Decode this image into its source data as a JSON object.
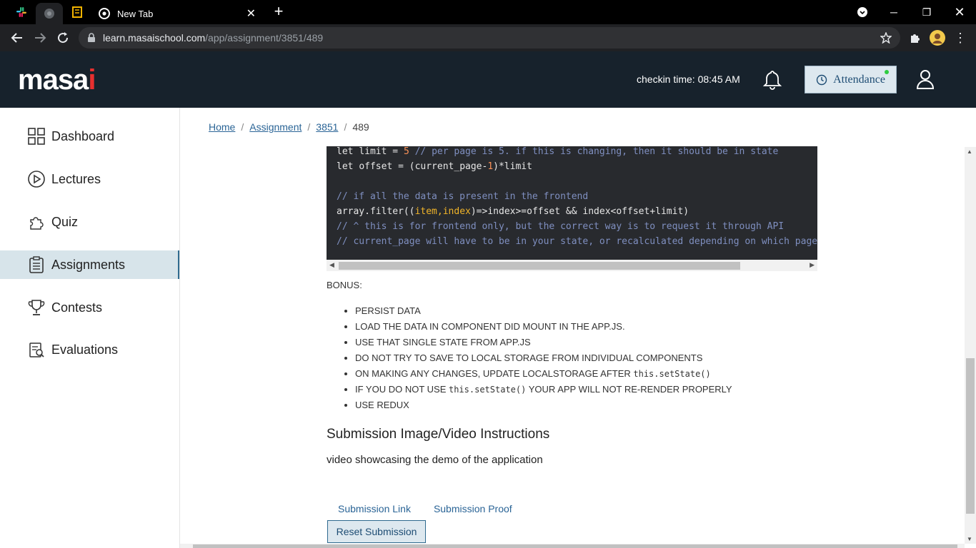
{
  "browser": {
    "active_tab_title": "New Tab",
    "url_host": "learn.masaischool.com",
    "url_path": "/app/assignment/3851/489"
  },
  "header": {
    "logo_main": "masa",
    "logo_accent": "i",
    "checkin": "checkin time: 08:45 AM",
    "attendance_label": "Attendance"
  },
  "sidebar": {
    "items": [
      {
        "label": "Dashboard",
        "icon": "dashboard-icon"
      },
      {
        "label": "Lectures",
        "icon": "play-circle-icon"
      },
      {
        "label": "Quiz",
        "icon": "puzzle-icon"
      },
      {
        "label": "Assignments",
        "icon": "clipboard-icon",
        "active": true
      },
      {
        "label": "Contests",
        "icon": "trophy-icon"
      },
      {
        "label": "Evaluations",
        "icon": "evaluation-icon"
      }
    ]
  },
  "breadcrumb": {
    "home": "Home",
    "assignment": "Assignment",
    "id": "3851",
    "current": "489"
  },
  "code": {
    "l1_kw": "let ",
    "l1_var": "limit = ",
    "l1_num": "5",
    "l1_cm": " // per page is 5. if this is changing, then it should be in state",
    "l2_kw": "let ",
    "l2_a": "offset = (current_page-",
    "l2_num": "1",
    "l2_b": ")*limit",
    "l4_cm": "// if all the data is present in the frontend",
    "l5_a": "array.filter((",
    "l5_p": "item,index",
    "l5_b": ")=>index>=offset && index<offset+limit)",
    "l6_cm": "// ^ this is for frontend only, but the correct way is to request it through API",
    "l7_cm": "// current_page will have to be in your state, or recalculated depending on which page i"
  },
  "bonus": {
    "title": "BONUS:",
    "items": [
      "PERSIST DATA",
      "LOAD THE DATA IN COMPONENT DID MOUNT IN THE APP.JS.",
      "USE THAT SINGLE STATE FROM APP.JS",
      "DO NOT TRY TO SAVE TO LOCAL STORAGE FROM INDIVIDUAL COMPONENTS"
    ],
    "item5_text": "ON MAKING ANY CHANGES, UPDATE LOCALSTORAGE AFTER ",
    "item5_code": "this.setState()",
    "item6_pre": "IF YOU DO NOT USE ",
    "item6_code": "this.setState()",
    "item6_post": " YOUR APP WILL NOT RE-RENDER PROPERLY",
    "item7": "USE REDUX"
  },
  "submission": {
    "heading": "Submission Image/Video Instructions",
    "text": "video showcasing the demo of the application",
    "tab_link": "Submission Link",
    "tab_proof": "Submission Proof",
    "reset": "Reset Submission"
  }
}
